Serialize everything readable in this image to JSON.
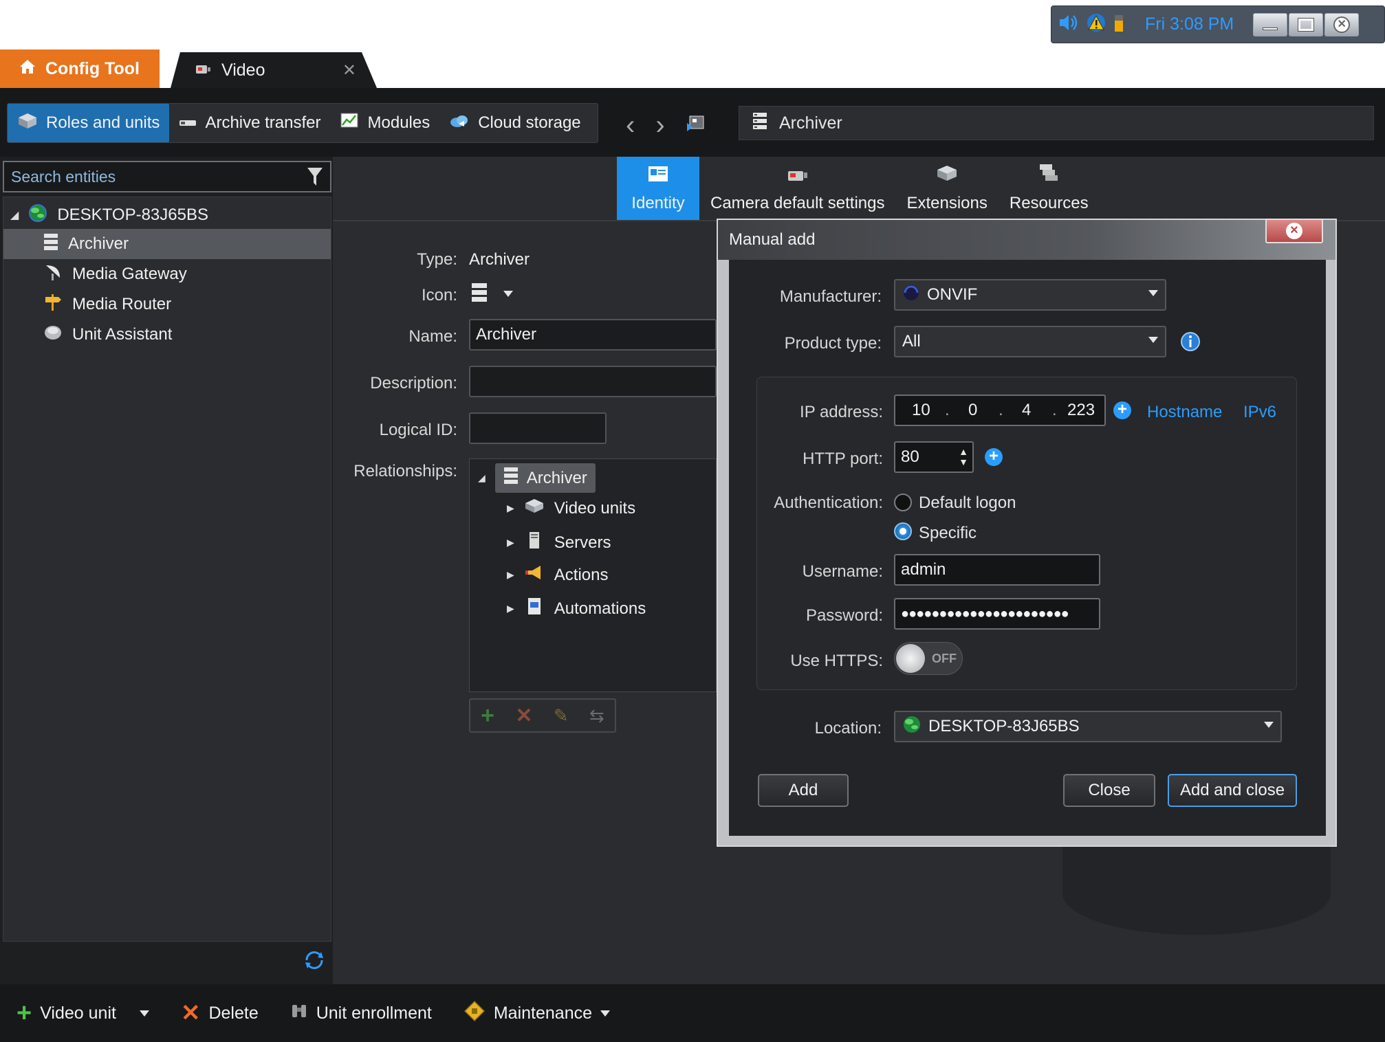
{
  "taskbar": {
    "clock": "Fri 3:08 PM"
  },
  "app_tabs": {
    "config_tool": "Config Tool",
    "video": "Video",
    "close_glyph": "✕"
  },
  "toolbar": {
    "module_tabs": [
      "Roles and units",
      "Archive transfer",
      "Modules",
      "Cloud storage"
    ],
    "nav_back": "‹",
    "nav_forward": "›",
    "breadcrumb": "Archiver"
  },
  "sidebar": {
    "search_placeholder": "Search entities",
    "root": "DESKTOP-83J65BS",
    "items": [
      "Archiver",
      "Media Gateway",
      "Media Router",
      "Unit Assistant"
    ]
  },
  "page_tabs": [
    "Identity",
    "Camera default settings",
    "Extensions",
    "Resources"
  ],
  "identity": {
    "type_label": "Type:",
    "type_value": "Archiver",
    "icon_label": "Icon:",
    "name_label": "Name:",
    "name_value": "Archiver",
    "description_label": "Description:",
    "description_value": "",
    "logical_id_label": "Logical ID:",
    "logical_id_value": "",
    "relationships_label": "Relationships:",
    "relationships": {
      "root": "Archiver",
      "children": [
        "Video units",
        "Servers",
        "Actions",
        "Automations"
      ]
    }
  },
  "dialog": {
    "title": "Manual add",
    "manufacturer_label": "Manufacturer:",
    "manufacturer_value": "ONVIF",
    "product_type_label": "Product type:",
    "product_type_value": "All",
    "ip_label": "IP address:",
    "ip_octets": [
      "10",
      "0",
      "4",
      "223"
    ],
    "ip_dot": ".",
    "hostname_link": "Hostname",
    "ipv6_link": "IPv6",
    "http_port_label": "HTTP port:",
    "http_port_value": "80",
    "auth_label": "Authentication:",
    "auth_options": [
      "Default logon",
      "Specific"
    ],
    "auth_selected": "Specific",
    "username_label": "Username:",
    "username_value": "admin",
    "password_label": "Password:",
    "password_value": "●●●●●●●●●●●●●●●●●●●●●●",
    "https_label": "Use HTTPS:",
    "https_state": "OFF",
    "location_label": "Location:",
    "location_value": "DESKTOP-83J65BS",
    "add_button": "Add",
    "close_button": "Close",
    "add_close_button": "Add and close"
  },
  "bottom_bar": {
    "video_unit": "Video unit",
    "delete": "Delete",
    "unit_enrollment": "Unit enrollment",
    "maintenance": "Maintenance"
  },
  "colors": {
    "accent_orange": "#e8741d",
    "accent_blue": "#1e8fe8",
    "link_blue": "#2a9dff"
  },
  "icons": [
    "speaker-icon",
    "warning-icon",
    "battery-icon",
    "minimize-icon",
    "maximize-icon",
    "close-icon",
    "home-icon",
    "camera-icon",
    "cube-icon",
    "server-icon",
    "chart-icon",
    "cloud-icon",
    "filter-icon",
    "globe-icon",
    "refresh-icon",
    "info-icon"
  ]
}
